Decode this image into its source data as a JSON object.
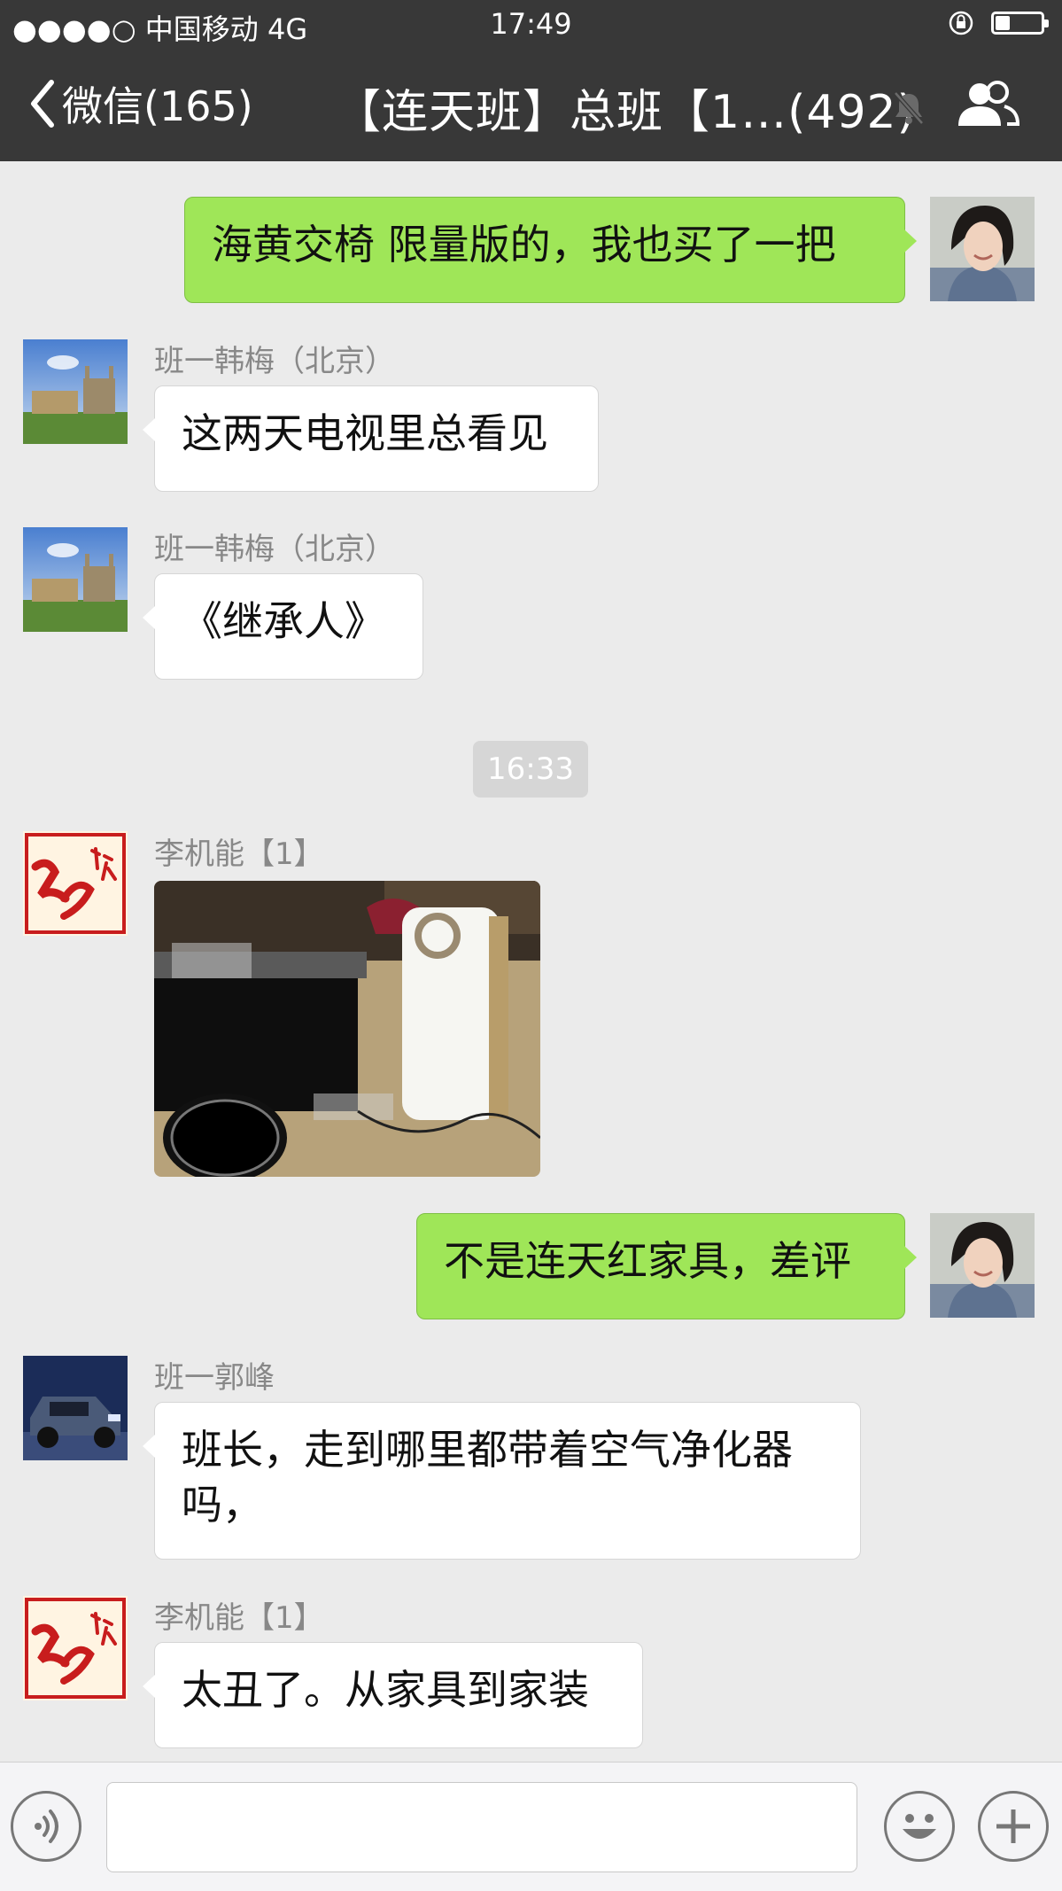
{
  "status_bar": {
    "carrier": "●●●●○ 中国移动   4G",
    "time": "17:49"
  },
  "nav": {
    "back_label": "微信(165)",
    "title": "【连天班】总班【1…(492)"
  },
  "messages": [
    {
      "sender": "",
      "text": "海黄交椅 限量版的，我也买了一把"
    },
    {
      "sender": "班一韩梅（北京）",
      "text": "这两天电视里总看见"
    },
    {
      "sender": "班一韩梅（北京）",
      "text": "《继承人》"
    },
    {
      "timestamp": "16:33"
    },
    {
      "sender": "李机能【1】",
      "image": "photo-air-purifier"
    },
    {
      "sender": "",
      "text": "不是连天红家具，差评"
    },
    {
      "sender": "班一郭峰",
      "text": "班长，走到哪里都带着空气净化器吗，"
    },
    {
      "sender": "李机能【1】",
      "text": "太丑了。从家具到家装"
    }
  ],
  "input_bar": {
    "value": ""
  },
  "colors": {
    "nav_bg": "#383838",
    "chat_bg": "#ebebeb",
    "outgoing_bubble": "#9fe658",
    "incoming_bubble": "#ffffff"
  },
  "icons": [
    "back-chevron-icon",
    "mute-bell-icon",
    "group-members-icon",
    "voice-icon",
    "emoji-icon",
    "plus-icon",
    "screen-lock-icon"
  ]
}
